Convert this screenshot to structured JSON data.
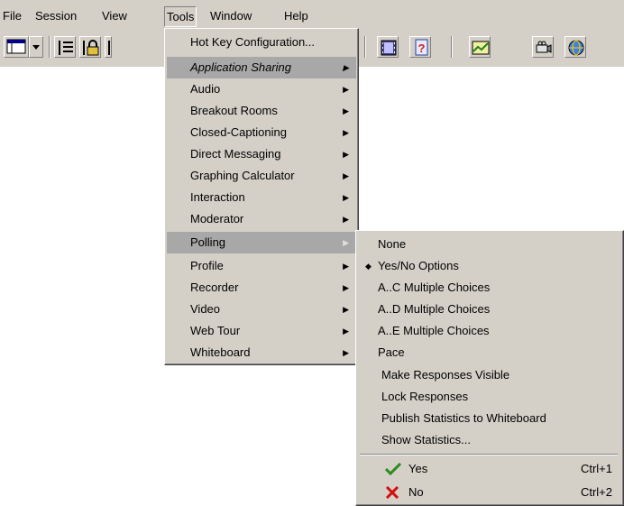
{
  "menubar": {
    "items": [
      {
        "label": "File"
      },
      {
        "label": "Session"
      },
      {
        "label": "View"
      },
      {
        "label": "Tools"
      },
      {
        "label": "Window"
      },
      {
        "label": "Help"
      }
    ]
  },
  "tools_menu": {
    "items": [
      {
        "label": "Hot Key Configuration..."
      },
      {
        "label": "Application Sharing"
      },
      {
        "label": "Audio"
      },
      {
        "label": "Breakout Rooms"
      },
      {
        "label": "Closed-Captioning"
      },
      {
        "label": "Direct Messaging"
      },
      {
        "label": "Graphing Calculator"
      },
      {
        "label": "Interaction"
      },
      {
        "label": "Moderator"
      },
      {
        "label": "Polling"
      },
      {
        "label": "Profile"
      },
      {
        "label": "Recorder"
      },
      {
        "label": "Video"
      },
      {
        "label": "Web Tour"
      },
      {
        "label": "Whiteboard"
      }
    ]
  },
  "polling_menu": {
    "items": [
      {
        "label": "None"
      },
      {
        "label": "Yes/No Options"
      },
      {
        "label": "A..C Multiple Choices"
      },
      {
        "label": "A..D Multiple Choices"
      },
      {
        "label": "A..E Multiple Choices"
      },
      {
        "label": "Pace"
      },
      {
        "label": "Make Responses Visible"
      },
      {
        "label": "Lock Responses"
      },
      {
        "label": "Publish Statistics to Whiteboard"
      },
      {
        "label": "Show Statistics..."
      },
      {
        "label": "Yes",
        "shortcut": "Ctrl+1"
      },
      {
        "label": "No",
        "shortcut": "Ctrl+2"
      }
    ]
  },
  "colors": {
    "face": "#d4d0c8",
    "highlight": "#a8a8a8",
    "check_green": "#2e8b1e",
    "x_red": "#d01010"
  }
}
